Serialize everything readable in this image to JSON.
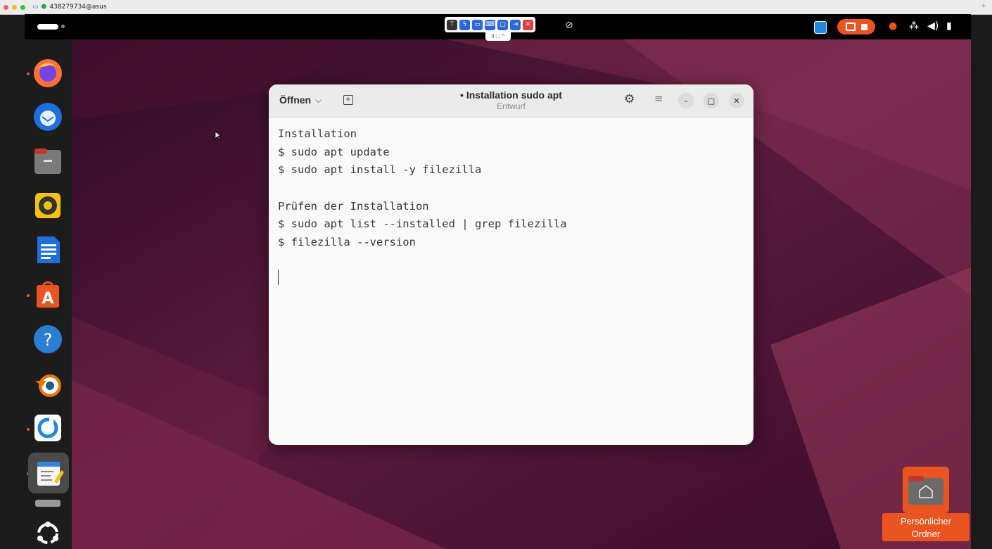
{
  "remote_viewer": {
    "title": "438279734@asus"
  },
  "topbar": {
    "toolbar_buttons": [
      "pin-icon",
      "lightning-icon",
      "monitor-icon",
      "keyboard-icon",
      "chat-icon",
      "cad-icon",
      "close-icon"
    ],
    "handle_text": "⠿ ⛶ ^",
    "mic_muted_icon": "mic-off-icon",
    "tray_icons": [
      "remote-app-icon",
      "screen-record-icon",
      "stop-icon",
      "mic-icon",
      "network-icon",
      "volume-icon",
      "battery-icon"
    ]
  },
  "dock": {
    "apps": [
      {
        "name": "Firefox",
        "icon": "firefox-icon",
        "running": true
      },
      {
        "name": "Thunderbird",
        "icon": "thunderbird-icon",
        "running": false
      },
      {
        "name": "Files",
        "icon": "files-icon",
        "running": false
      },
      {
        "name": "Rhythmbox",
        "icon": "rhythmbox-icon",
        "running": false
      },
      {
        "name": "LibreOffice Writer",
        "icon": "writer-icon",
        "running": false
      },
      {
        "name": "App Center",
        "icon": "app-center-icon",
        "running": true
      },
      {
        "name": "Help",
        "icon": "help-icon",
        "running": false
      },
      {
        "name": "Blender",
        "icon": "blender-icon",
        "running": false
      },
      {
        "name": "Remote Desktop",
        "icon": "remote-desktop-icon",
        "running": true
      },
      {
        "name": "Text Editor",
        "icon": "text-editor-icon",
        "running": true,
        "active": true
      },
      {
        "name": "Drive",
        "icon": "drive-icon",
        "running": false
      },
      {
        "name": "Show Apps",
        "icon": "ubuntu-apps-icon",
        "running": false
      }
    ]
  },
  "editor_window": {
    "open_label": "Öffnen",
    "title": "• Installation sudo apt",
    "subtitle": "Entwurf",
    "lines": [
      "Installation",
      "$ sudo apt update",
      "$ sudo apt install -y filezilla",
      "",
      "Prüfen der Installation",
      "$ sudo apt list --installed | grep filezilla",
      "$ filezilla --version"
    ]
  },
  "desktop": {
    "home_folder_label_line1": "Persönlicher",
    "home_folder_label_line2": "Ordner"
  },
  "colors": {
    "ubuntu_orange": "#e95420",
    "wallpaper_base": "#3a0f2c",
    "tool_blue": "#2b68e0"
  }
}
